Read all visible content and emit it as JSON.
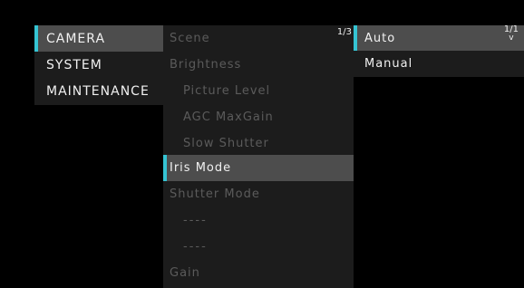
{
  "left_menu": {
    "items": [
      {
        "label": "CAMERA"
      },
      {
        "label": "SYSTEM"
      },
      {
        "label": "MAINTENANCE"
      }
    ]
  },
  "middle_menu": {
    "page": "1/3",
    "items": [
      {
        "label": "Scene"
      },
      {
        "label": "Brightness"
      },
      {
        "label": "Picture Level"
      },
      {
        "label": "AGC MaxGain"
      },
      {
        "label": "Slow Shutter"
      },
      {
        "label": "Iris Mode"
      },
      {
        "label": "Shutter Mode"
      },
      {
        "label": "----"
      },
      {
        "label": "----"
      },
      {
        "label": "Gain"
      }
    ]
  },
  "right_menu": {
    "page": "1/1",
    "scroll_indicator": "v",
    "items": [
      {
        "label": "Auto"
      },
      {
        "label": "Manual"
      }
    ]
  },
  "colors": {
    "background": "#000000",
    "menu_bg": "#1c1c1c",
    "highlight_bg": "#4d4d4d",
    "accent": "#35c4d3",
    "text": "#f1f1f1",
    "disabled_text": "#5b5b5b"
  }
}
